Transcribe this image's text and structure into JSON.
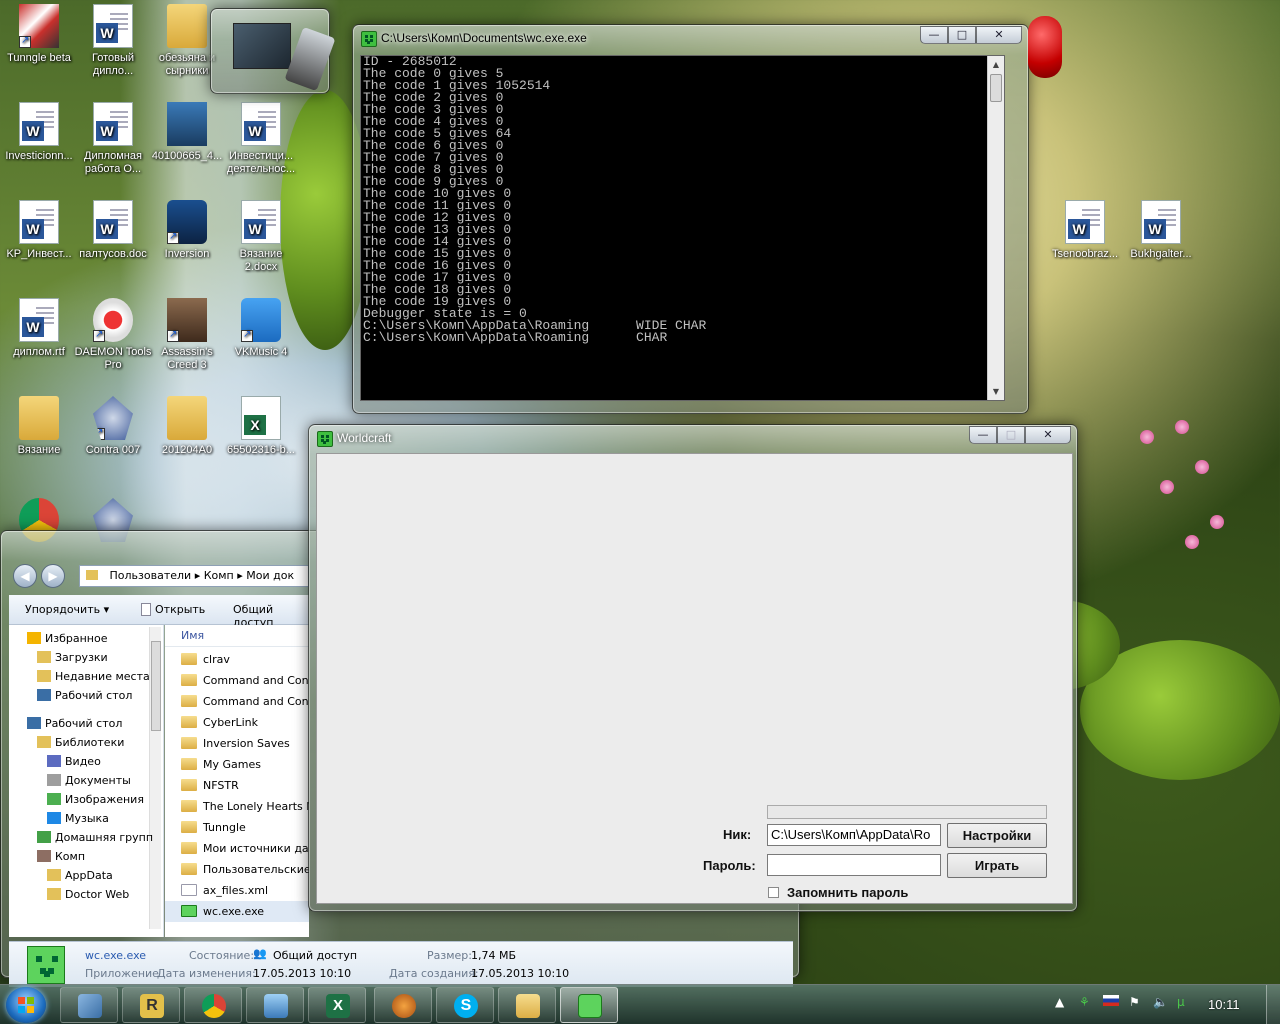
{
  "desktop": {
    "icons": [
      {
        "label": "Tunngle beta",
        "kind": "app1"
      },
      {
        "label": "Готовый дипло...",
        "kind": "word"
      },
      {
        "label": "обезьяна и сырники",
        "kind": "folder"
      },
      {
        "label": "Investicionn...",
        "kind": "word"
      },
      {
        "label": "Дипломная работа О...",
        "kind": "word"
      },
      {
        "label": "40100665_4...",
        "kind": "app7"
      },
      {
        "label": "Инвестици... деятельнос...",
        "kind": "word"
      },
      {
        "label": "KP_Инвест...",
        "kind": "word"
      },
      {
        "label": "палтусов.doc",
        "kind": "word"
      },
      {
        "label": "Inversion",
        "kind": "app3"
      },
      {
        "label": "Вязание 2.docx",
        "kind": "word"
      },
      {
        "label": "диплом.rtf",
        "kind": "word"
      },
      {
        "label": "DAEMON Tools Pro",
        "kind": "app2"
      },
      {
        "label": "Assassin's Creed 3",
        "kind": "app4"
      },
      {
        "label": "VKMusic 4",
        "kind": "app5"
      },
      {
        "label": "Вязание",
        "kind": "folder"
      },
      {
        "label": "Contra 007",
        "kind": "app6"
      },
      {
        "label": "201204A0",
        "kind": "folder"
      },
      {
        "label": "65502316-b...",
        "kind": "excel"
      },
      {
        "label": "Tsenoobraz...",
        "kind": "word"
      },
      {
        "label": "Bukhgalter...",
        "kind": "word"
      }
    ]
  },
  "console_window": {
    "title": "C:\\Users\\Комп\\Documents\\wc.exe.exe",
    "lines": [
      "ID - 2685012",
      "The code 0 gives 5",
      "The code 1 gives 1052514",
      "The code 2 gives 0",
      "The code 3 gives 0",
      "The code 4 gives 0",
      "The code 5 gives 64",
      "The code 6 gives 0",
      "The code 7 gives 0",
      "The code 8 gives 0",
      "The code 9 gives 0",
      "The code 10 gives 0",
      "The code 11 gives 0",
      "The code 12 gives 0",
      "The code 13 gives 0",
      "The code 14 gives 0",
      "The code 15 gives 0",
      "The code 16 gives 0",
      "The code 17 gives 0",
      "The code 18 gives 0",
      "The code 19 gives 0",
      "Debugger state is = 0",
      "C:\\Users\\Комп\\AppData\\Roaming      WIDE CHAR",
      "C:\\Users\\Комп\\AppData\\Roaming      CHAR"
    ],
    "buttons": {
      "minimize": "—",
      "maximize": "□",
      "close": "✕"
    }
  },
  "worldcraft_window": {
    "title": "Worldcraft",
    "nick_label": "Ник:",
    "nick_value": "C:\\Users\\Комп\\AppData\\Ro",
    "password_label": "Пароль:",
    "password_value": "",
    "settings_button": "Настройки",
    "play_button": "Играть",
    "remember_label": "Запомнить пароль",
    "remember_checked": false,
    "buttons": {
      "minimize": "—",
      "maximize": "□",
      "close": "✕"
    }
  },
  "explorer_window": {
    "breadcrumb": [
      "Пользователи",
      "Комп",
      "Мои док"
    ],
    "toolbar": {
      "organize": "Упорядочить",
      "open": "Открыть",
      "share": "Общий доступ"
    },
    "nav": [
      {
        "label": "Избранное",
        "level": 0
      },
      {
        "label": "Загрузки",
        "level": 1
      },
      {
        "label": "Недавние места",
        "level": 1
      },
      {
        "label": "Рабочий стол",
        "level": 1
      },
      {
        "label": "Рабочий стол",
        "level": 0
      },
      {
        "label": "Библиотеки",
        "level": 1
      },
      {
        "label": "Видео",
        "level": 2
      },
      {
        "label": "Документы",
        "level": 2
      },
      {
        "label": "Изображения",
        "level": 2
      },
      {
        "label": "Музыка",
        "level": 2
      },
      {
        "label": "Домашняя групп",
        "level": 1
      },
      {
        "label": "Комп",
        "level": 1
      },
      {
        "label": "AppData",
        "level": 2
      },
      {
        "label": "Doctor Web",
        "level": 2
      }
    ],
    "column_header": "Имя",
    "files": [
      {
        "name": "clrav",
        "type": "folder"
      },
      {
        "name": "Command and Conq",
        "type": "folder"
      },
      {
        "name": "Command and Conq",
        "type": "folder"
      },
      {
        "name": "CyberLink",
        "type": "folder"
      },
      {
        "name": "Inversion Saves",
        "type": "folder"
      },
      {
        "name": "My Games",
        "type": "folder"
      },
      {
        "name": "NFSTR",
        "type": "folder"
      },
      {
        "name": "The Lonely Hearts Mu",
        "type": "folder"
      },
      {
        "name": "Tunngle",
        "type": "folder"
      },
      {
        "name": "Мои источники дан",
        "type": "folder"
      },
      {
        "name": "Пользовательские ш",
        "type": "folder"
      },
      {
        "name": "ax_files.xml",
        "type": "file"
      },
      {
        "name": "wc.exe.exe",
        "type": "exe",
        "selected": true
      }
    ],
    "details": {
      "filename": "wc.exe.exe",
      "type_label": "Приложение",
      "state_label": "Состояние:",
      "state_value": "Общий доступ",
      "size_label": "Размер:",
      "size_value": "1,74 МБ",
      "modified_label": "Дата изменения:",
      "modified_value": "17.05.2013 10:10",
      "created_label": "Дата создания:",
      "created_value": "17.05.2013 10:10"
    }
  },
  "taskbar": {
    "apps": [
      "outlook-icon",
      "r-app-icon",
      "chrome-icon",
      "image-viewer-icon",
      "excel-icon",
      "game-icon",
      "skype-icon",
      "explorer-icon",
      "worldcraft-icon"
    ],
    "clock": "10:11"
  }
}
